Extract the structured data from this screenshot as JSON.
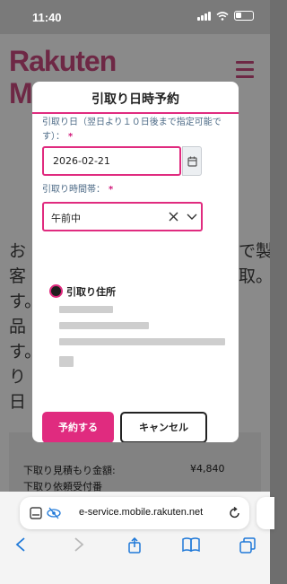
{
  "status_bar": {
    "time": "11:40"
  },
  "background_page": {
    "logo_line1": "Rakuten",
    "logo_line2": "Mo",
    "left_text": "お客す。品す。り日",
    "right_text": "で製取。",
    "summary": [
      {
        "label": "下取り見積もり金額:",
        "amount": "¥4,840"
      },
      {
        "label": "下取り依頼受付番",
        "amount": ""
      }
    ]
  },
  "modal": {
    "title": "引取り日時予約",
    "date_label": "引取り日（翌日より１０日後まで指定可能です）：",
    "required_mark": "*",
    "date_value": "2026-02-21",
    "time_label": "引取り時間帯：",
    "time_value": "午前中",
    "address_label": "引取り住所",
    "reserve_button": "予約する",
    "cancel_button": "キャンセル"
  },
  "browser": {
    "url": "e-service.mobile.rakuten.net"
  },
  "colors": {
    "accent": "#e02b7f",
    "label": "#4c6a86"
  },
  "icons": [
    "calendar-icon",
    "clear-icon",
    "chevron-down-icon",
    "reload-icon",
    "back-icon",
    "forward-icon",
    "share-icon",
    "bookmarks-icon",
    "tabs-icon"
  ]
}
